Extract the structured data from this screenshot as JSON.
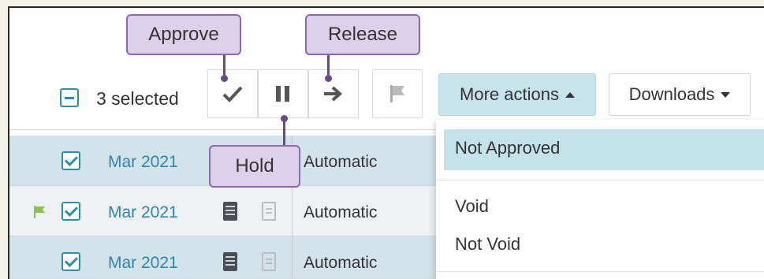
{
  "toolbar": {
    "selected_count_label": "3 selected",
    "more_actions_label": "More actions",
    "downloads_label": "Downloads",
    "buttons": [
      {
        "name": "approve",
        "icon": "check-icon"
      },
      {
        "name": "hold",
        "icon": "pause-icon"
      },
      {
        "name": "release",
        "icon": "arrow-right-icon"
      },
      {
        "name": "flag",
        "icon": "flag-icon"
      }
    ]
  },
  "callouts": {
    "approve": "Approve",
    "release": "Release",
    "hold": "Hold"
  },
  "rows": [
    {
      "date": "Mar 2021",
      "type": "Automatic",
      "checked": true,
      "flagged": false
    },
    {
      "date": "Mar 2021",
      "type": "Automatic",
      "checked": true,
      "flagged": true
    },
    {
      "date": "Mar 2021",
      "type": "Automatic",
      "checked": true,
      "flagged": false
    }
  ],
  "menu": {
    "items": [
      "Not Approved",
      "Void",
      "Not Void"
    ],
    "active_item": "Not Approved"
  },
  "colors": {
    "accent": "#2c8fa8",
    "link": "#2f86ad",
    "callout_fill": "#ddd0ea",
    "callout_border": "#8a6aa8",
    "row_selected": "#d3e3ea",
    "menu_active": "#c3e2ea",
    "flag_green": "#8cc152"
  }
}
